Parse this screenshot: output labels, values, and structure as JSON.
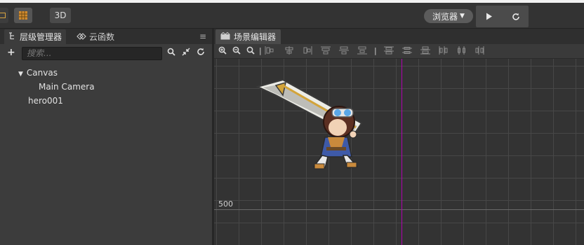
{
  "toolbar": {
    "mode_3d_label": "3D",
    "browser_label": "浏览器",
    "browser_caret": "▼",
    "play_glyph": "▶",
    "refresh_glyph": "↻"
  },
  "hierarchy": {
    "tab_label": "层级管理器",
    "cloud_tab_label": "云函数",
    "search_placeholder": "搜索...",
    "nodes": [
      {
        "label": "Canvas",
        "expanded": true
      },
      {
        "label": "Main Camera"
      },
      {
        "label": "hero001"
      }
    ]
  },
  "scene": {
    "tab_label": "场景编辑器",
    "ruler_label": "500",
    "colors": {
      "center_line": "#b000b0",
      "grid": "#474747",
      "background": "#333333"
    }
  },
  "icons": [
    "window-icon",
    "grid-icon",
    "hierarchy-icon",
    "cloud-icon",
    "menu-icon",
    "add-icon",
    "search-icon",
    "collapse-icon",
    "refresh-icon",
    "scene-icon",
    "zoom-in-icon",
    "zoom-out-icon",
    "zoom-reset-icon",
    "align-icons"
  ]
}
